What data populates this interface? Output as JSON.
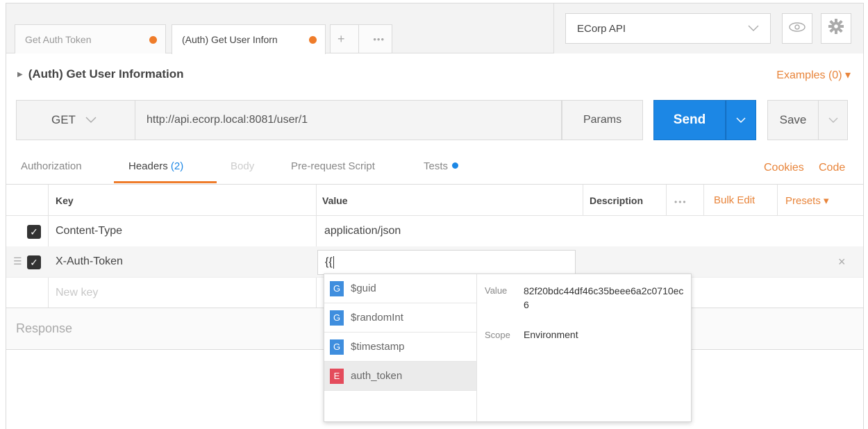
{
  "tabs": [
    {
      "label": "Get Auth Token"
    },
    {
      "label": "(Auth) Get User Inforn"
    }
  ],
  "tab_plus": "+",
  "tab_more": "•••",
  "environment": {
    "selected": "ECorp API"
  },
  "request": {
    "title": "(Auth) Get User Information",
    "examples": "Examples (0) ▾",
    "method": "GET",
    "url": "http://api.ecorp.local:8081/user/1",
    "params_label": "Params",
    "send_label": "Send",
    "save_label": "Save"
  },
  "request_tabs": {
    "authorization": "Authorization",
    "headers": "Headers",
    "headers_count": "(2)",
    "body": "Body",
    "prerequest": "Pre-request Script",
    "tests": "Tests",
    "cookies": "Cookies",
    "code": "Code"
  },
  "headers_table": {
    "col_key": "Key",
    "col_value": "Value",
    "col_description": "Description",
    "more": "•••",
    "bulk_edit": "Bulk Edit",
    "presets": "Presets ▾",
    "rows": [
      {
        "key": "Content-Type",
        "value": "application/json",
        "checked": true
      },
      {
        "key": "X-Auth-Token",
        "value": "{{",
        "checked": true
      }
    ],
    "new_key_placeholder": "New key",
    "remove_icon": "×"
  },
  "response": {
    "label": "Response"
  },
  "autocomplete": {
    "items": [
      {
        "badge": "G",
        "label": "$guid"
      },
      {
        "badge": "G",
        "label": "$randomInt"
      },
      {
        "badge": "G",
        "label": "$timestamp"
      },
      {
        "badge": "E",
        "label": "auth_token"
      }
    ],
    "detail": {
      "value_label": "Value",
      "value": "82f20bdc44df46c35beee6a2c0710ec6",
      "scope_label": "Scope",
      "scope": "Environment"
    }
  },
  "colors": {
    "accent": "#ef7c2a",
    "send": "#1c87e5",
    "global_badge": "#3f8ede",
    "env_badge": "#e44c5c"
  }
}
